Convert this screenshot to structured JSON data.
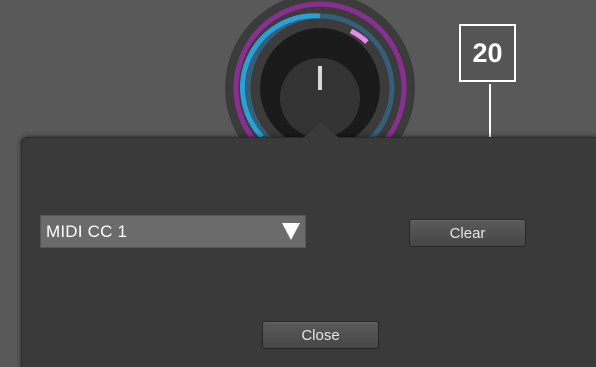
{
  "callout": {
    "number": "20"
  },
  "knob": {
    "outer_ring_color": "#8a2f92",
    "inner_ring_color": "#2aa0d8",
    "marker_color": "#e98ae8"
  },
  "popup": {
    "select": {
      "selected": "MIDI CC 1"
    },
    "clear_label": "Clear",
    "close_label": "Close"
  }
}
